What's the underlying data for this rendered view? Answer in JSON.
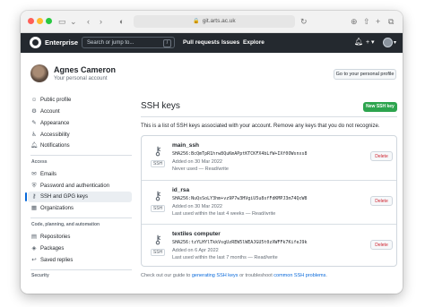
{
  "browser": {
    "url": "git.arts.ac.uk"
  },
  "header": {
    "brand": "Enterprise",
    "search_placeholder": "Search or jump to...",
    "search_shortcut": "/",
    "nav": [
      "Pull requests",
      "Issues",
      "Explore"
    ],
    "bell_icon": "bell-icon",
    "plus_label": "+ ▾",
    "avatar_caret": "▾"
  },
  "profile": {
    "name": "Agnes Cameron",
    "subtitle": "Your personal account",
    "profile_button": "Go to your personal profile"
  },
  "sidebar": {
    "items": [
      {
        "label": "Public profile",
        "icon": "person-icon"
      },
      {
        "label": "Account",
        "icon": "gear-icon"
      },
      {
        "label": "Appearance",
        "icon": "paintbrush-icon"
      },
      {
        "label": "Accessibility",
        "icon": "accessibility-icon"
      },
      {
        "label": "Notifications",
        "icon": "bell-icon"
      }
    ],
    "access_heading": "Access",
    "access_items": [
      {
        "label": "Emails",
        "icon": "mail-icon"
      },
      {
        "label": "Password and authentication",
        "icon": "shield-icon"
      },
      {
        "label": "SSH and GPG keys",
        "icon": "key-icon",
        "active": true
      },
      {
        "label": "Organizations",
        "icon": "organization-icon"
      }
    ],
    "code_heading": "Code, planning, and automation",
    "code_items": [
      {
        "label": "Repositories",
        "icon": "repo-icon"
      },
      {
        "label": "Packages",
        "icon": "package-icon"
      },
      {
        "label": "Saved replies",
        "icon": "reply-icon"
      }
    ],
    "security_heading": "Security"
  },
  "main": {
    "title": "SSH keys",
    "new_button": "New SSH key",
    "intro": "This is a list of SSH keys associated with your account. Remove any keys that you do not recognize.",
    "key_type_label": "SSH",
    "delete_label": "Delete",
    "keys": [
      {
        "name": "main_ssh",
        "fingerprint": "SHA256:BcQmTpR1hrw8QuKmAPptKTCKFX4bLfW+IXf0OWsnxs8",
        "added": "Added on 30 Mar 2022",
        "used": "Never used — Read/write"
      },
      {
        "name": "id_rsa",
        "fingerprint": "SHA256:NuQsSoLY3hm+vz9P7w3HVgiU5u8sfFdKMPJ3m74QcW8",
        "added": "Added on 30 Mar 2022",
        "used": "Last used within the last 4 weeks — Read/write"
      },
      {
        "name": "textiles computer",
        "fingerprint": "SHA256:tzYLHYlTkkVsgUzREW5lWEAJGU5t0zXWFFk7KifeJ9k",
        "added": "Added on 6 Apr 2022",
        "used": "Last used within the last 7 months — Read/write"
      }
    ],
    "footer_pre": "Check out our guide to ",
    "footer_link1": "generating SSH keys",
    "footer_mid": " or troubleshoot ",
    "footer_link2": "common SSH problems",
    "footer_post": "."
  }
}
